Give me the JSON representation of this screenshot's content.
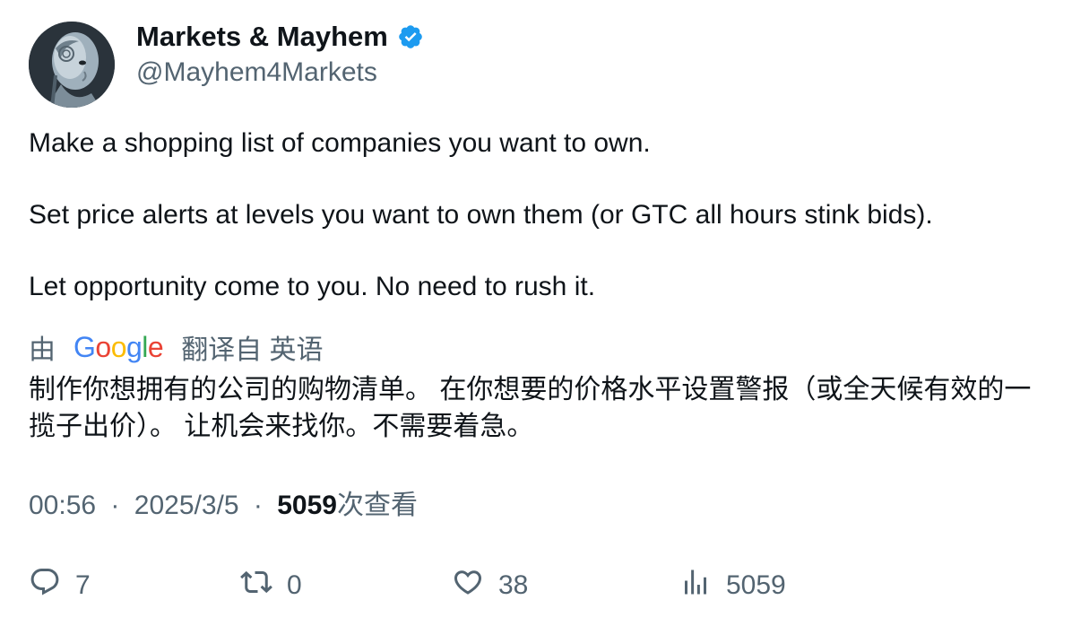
{
  "author": {
    "display_name": "Markets & Mayhem",
    "handle": "@Mayhem4Markets",
    "verified_icon": "verified-badge-icon",
    "avatar_icon": "robot-head-avatar"
  },
  "tweet": {
    "paragraphs": [
      "Make a shopping list of companies you want to own.",
      "Set price alerts at levels you want to own them (or GTC all hours stink bids).",
      "Let opportunity come to you. No need to rush it."
    ]
  },
  "translation": {
    "prefix": "由",
    "provider": "Google",
    "suffix": "翻译自 英语",
    "text": "制作你想拥有的公司的购物清单。 在你想要的价格水平设置警报（或全天候有效的一揽子出价）。 让机会来找你。不需要着急。"
  },
  "meta": {
    "time": "00:56",
    "separator": "·",
    "date": "2025/3/5",
    "views_count": "5059",
    "views_label": "次查看"
  },
  "actions": {
    "reply": "7",
    "repost": "0",
    "like": "38",
    "views": "5059"
  },
  "colors": {
    "primary_text": "#0f1419",
    "secondary_text": "#536471",
    "verified_blue": "#1d9bf0"
  }
}
